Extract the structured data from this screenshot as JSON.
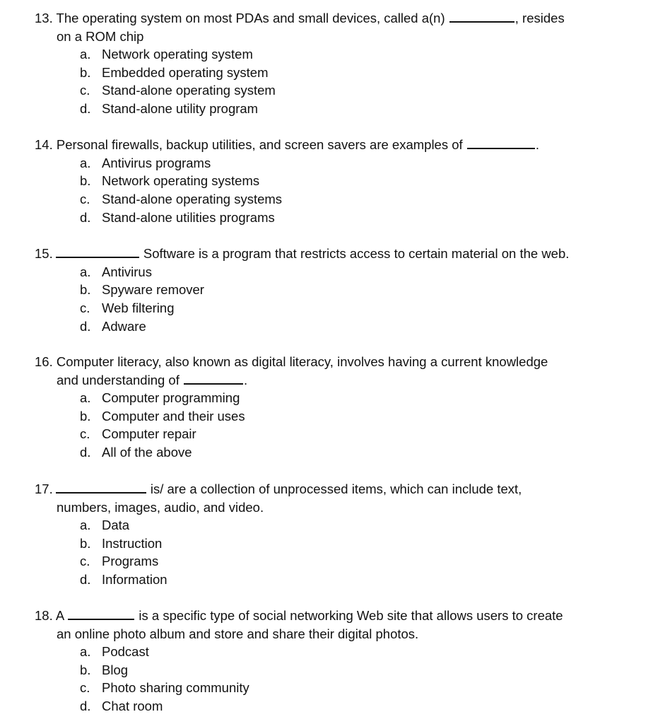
{
  "questions": [
    {
      "number": "13.",
      "before": "The operating system on most PDAs and small devices, called a(n) ",
      "after": ", resides",
      "continuation": "on a ROM chip",
      "options": [
        {
          "letter": "a.",
          "text": "Network operating system"
        },
        {
          "letter": "b.",
          "text": "Embedded operating system"
        },
        {
          "letter": "c.",
          "text": "Stand-alone operating system"
        },
        {
          "letter": "d.",
          "text": "Stand-alone utility program"
        }
      ]
    },
    {
      "number": "14.",
      "before": "Personal firewalls, backup utilities, and screen savers are examples of ",
      "after": ".",
      "continuation": "",
      "options": [
        {
          "letter": "a.",
          "text": "Antivirus programs"
        },
        {
          "letter": "b.",
          "text": "Network operating systems"
        },
        {
          "letter": "c.",
          "text": "Stand-alone operating systems"
        },
        {
          "letter": "d.",
          "text": "Stand-alone utilities programs"
        }
      ]
    },
    {
      "number": "15.",
      "before": " ",
      "after": " Software is a program that restricts access to certain material on the web.",
      "continuation": "",
      "options": [
        {
          "letter": "a.",
          "text": "Antivirus"
        },
        {
          "letter": "b.",
          "text": "Spyware remover"
        },
        {
          "letter": "c.",
          "text": "Web filtering"
        },
        {
          "letter": "d.",
          "text": "Adware"
        }
      ]
    },
    {
      "number": "16.",
      "before": "Computer literacy, also known as digital literacy, involves having a current knowledge",
      "after": "",
      "continuation_before": "and understanding of ",
      "continuation_after": ".",
      "options": [
        {
          "letter": "a.",
          "text": "Computer programming"
        },
        {
          "letter": "b.",
          "text": "Computer and their uses"
        },
        {
          "letter": "c.",
          "text": "Computer repair"
        },
        {
          "letter": "d.",
          "text": "All of the above"
        }
      ]
    },
    {
      "number": "17.",
      "before": " ",
      "after": " is/ are a collection of unprocessed items, which can include text,",
      "continuation": "numbers, images, audio, and video.",
      "options": [
        {
          "letter": "a.",
          "text": "Data"
        },
        {
          "letter": "b.",
          "text": "Instruction"
        },
        {
          "letter": "c.",
          "text": "Programs"
        },
        {
          "letter": "d.",
          "text": "Information"
        }
      ]
    },
    {
      "number": "18.",
      "before": " A ",
      "after": " is a specific type of social networking Web site that allows users to create",
      "continuation": "an online photo album and store and share their digital photos.",
      "options": [
        {
          "letter": "a.",
          "text": "Podcast"
        },
        {
          "letter": "b.",
          "text": "Blog"
        },
        {
          "letter": "c.",
          "text": "Photo sharing community"
        },
        {
          "letter": "d.",
          "text": "Chat room"
        }
      ]
    }
  ]
}
